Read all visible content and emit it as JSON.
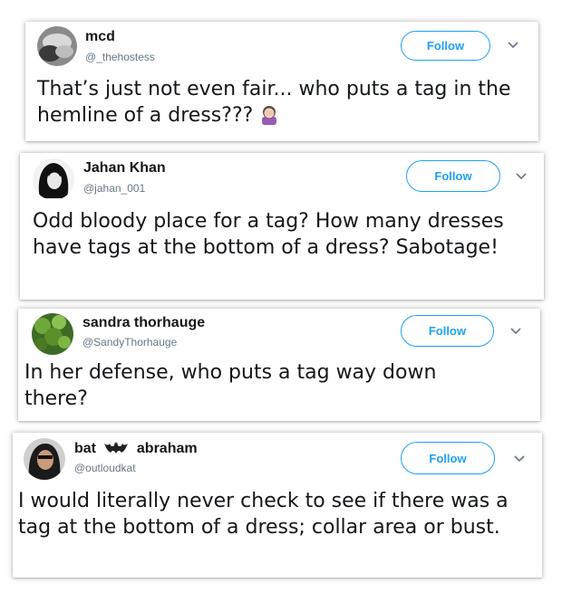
{
  "tweets": [
    {
      "name": "mcd",
      "handle": "@_thehostess",
      "follow_label": "Follow",
      "text": "That’s just not even fair... who puts a tag in the hemline of a dress???",
      "emoji": "woman-facepalming-icon"
    },
    {
      "name": "Jahan Khan",
      "handle": "@jahan_001",
      "follow_label": "Follow",
      "text": "Odd bloody place for a tag? How many dresses have tags at the bottom of a dress? Sabotage!"
    },
    {
      "name": "sandra thorhauge",
      "handle": "@SandyThorhauge",
      "follow_label": "Follow",
      "text": "In her defense, who puts a tag way down there?"
    },
    {
      "name_part1": "bat",
      "name_part2": "abraham",
      "name_icon": "bat-icon",
      "handle": "@outloudkat",
      "follow_label": "Follow",
      "text": "I would literally never check to see if there was a tag at the bottom of a dress; collar area or bust."
    }
  ],
  "colors": {
    "accent": "#1da1f2",
    "text": "#14171a",
    "secondary": "#657786"
  }
}
